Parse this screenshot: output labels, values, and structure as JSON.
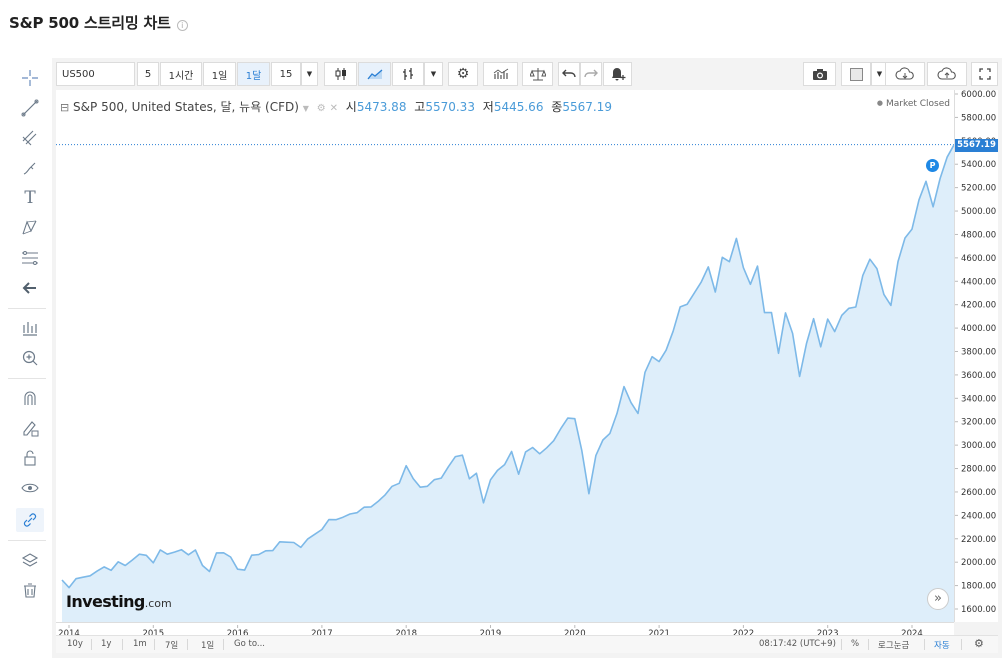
{
  "page": {
    "title": "S&P 500 스트리밍 차트",
    "info_icon": "info-icon"
  },
  "toolbar": {
    "symbol": "US500",
    "interval_5": "5",
    "interval_1h": "1시간",
    "interval_1d": "1일",
    "interval_1w": "1달",
    "interval_custom": "15",
    "dropdown_icon": "chevron-down-icon",
    "icons": [
      "candlestick-icon",
      "area-chart-icon",
      "ohlc-bars-icon",
      "settings-gear-icon",
      "indicators-icon",
      "compare-scale-icon",
      "undo-icon",
      "redo-icon",
      "add-alert-icon",
      "camera-icon",
      "color-square-icon",
      "cloud-download-icon",
      "cloud-upload-icon",
      "fullscreen-icon"
    ]
  },
  "left_tools": [
    "crosshair-icon",
    "trend-line-icon",
    "pitchfork-icon",
    "brush-icon",
    "text-icon",
    "pattern-icon",
    "fib-retracement-icon",
    "back-arrow-icon",
    "measure-icon",
    "zoom-in-icon",
    "magnet-icon",
    "lock-pencil-icon",
    "lock-open-icon",
    "eye-icon",
    "link-icon",
    "layers-icon",
    "trash-icon"
  ],
  "legend": {
    "name": "S&P 500, United States, 달, 뉴욕 (CFD)",
    "open_label": "시",
    "open": "5473.88",
    "high_label": "고",
    "high": "5570.33",
    "low_label": "저",
    "low": "5445.66",
    "close_label": "종",
    "close": "5567.19"
  },
  "market_status": "Market Closed",
  "logo": {
    "main": "Investing",
    "suffix": ".com"
  },
  "p_marker": "P",
  "last_price_tag": "5567.19",
  "bottom_bar": {
    "ranges": [
      "10y",
      "1y",
      "1m",
      "7일",
      "1일"
    ],
    "goto": "Go to...",
    "time": "08:17:42 (UTC+9)",
    "percent": "%",
    "log": "로그눈금",
    "auto": "자동",
    "settings_icon": "gear-icon"
  },
  "colors": {
    "line": "#7db9e8",
    "fill": "#deeefa",
    "accent": "#2a7fd4",
    "last_price_line": "#2a7fd4"
  },
  "chart_data": {
    "type": "area",
    "title": "S&P 500 스트리밍 차트",
    "xlabel": "",
    "ylabel": "",
    "ylim": [
      1500,
      6100
    ],
    "y_ticks": [
      1600,
      1800,
      2000,
      2200,
      2400,
      2600,
      2800,
      3000,
      3200,
      3400,
      3600,
      3800,
      4000,
      4200,
      4400,
      4600,
      4800,
      5000,
      5200,
      5400,
      5600,
      5800,
      6000
    ],
    "x_ticks": [
      "2014",
      "2015",
      "2016",
      "2017",
      "2018",
      "2019",
      "2020",
      "2021",
      "2022",
      "2023",
      "2024"
    ],
    "xlim": [
      "2013-11",
      "2024-07"
    ],
    "grid": false,
    "last_value": 5567.19,
    "series": [
      {
        "name": "S&P 500",
        "x": [
          "2013-12",
          "2014-01",
          "2014-02",
          "2014-03",
          "2014-04",
          "2014-05",
          "2014-06",
          "2014-07",
          "2014-08",
          "2014-09",
          "2014-10",
          "2014-11",
          "2014-12",
          "2015-01",
          "2015-02",
          "2015-03",
          "2015-04",
          "2015-05",
          "2015-06",
          "2015-07",
          "2015-08",
          "2015-09",
          "2015-10",
          "2015-11",
          "2015-12",
          "2016-01",
          "2016-02",
          "2016-03",
          "2016-04",
          "2016-05",
          "2016-06",
          "2016-07",
          "2016-08",
          "2016-09",
          "2016-10",
          "2016-11",
          "2016-12",
          "2017-01",
          "2017-02",
          "2017-03",
          "2017-04",
          "2017-05",
          "2017-06",
          "2017-07",
          "2017-08",
          "2017-09",
          "2017-10",
          "2017-11",
          "2017-12",
          "2018-01",
          "2018-02",
          "2018-03",
          "2018-04",
          "2018-05",
          "2018-06",
          "2018-07",
          "2018-08",
          "2018-09",
          "2018-10",
          "2018-11",
          "2018-12",
          "2019-01",
          "2019-02",
          "2019-03",
          "2019-04",
          "2019-05",
          "2019-06",
          "2019-07",
          "2019-08",
          "2019-09",
          "2019-10",
          "2019-11",
          "2019-12",
          "2020-01",
          "2020-02",
          "2020-03",
          "2020-04",
          "2020-05",
          "2020-06",
          "2020-07",
          "2020-08",
          "2020-09",
          "2020-10",
          "2020-11",
          "2020-12",
          "2021-01",
          "2021-02",
          "2021-03",
          "2021-04",
          "2021-05",
          "2021-06",
          "2021-07",
          "2021-08",
          "2021-09",
          "2021-10",
          "2021-11",
          "2021-12",
          "2022-01",
          "2022-02",
          "2022-03",
          "2022-04",
          "2022-05",
          "2022-06",
          "2022-07",
          "2022-08",
          "2022-09",
          "2022-10",
          "2022-11",
          "2022-12",
          "2023-01",
          "2023-02",
          "2023-03",
          "2023-04",
          "2023-05",
          "2023-06",
          "2023-07",
          "2023-08",
          "2023-09",
          "2023-10",
          "2023-11",
          "2023-12",
          "2024-01",
          "2024-02",
          "2024-03",
          "2024-04",
          "2024-05",
          "2024-06",
          "2024-07"
        ],
        "values": [
          1848,
          1783,
          1859,
          1872,
          1884,
          1924,
          1960,
          1931,
          2003,
          1972,
          2018,
          2068,
          2059,
          1995,
          2105,
          2068,
          2086,
          2107,
          2063,
          2104,
          1972,
          1920,
          2079,
          2080,
          2044,
          1940,
          1932,
          2060,
          2065,
          2097,
          2099,
          2174,
          2171,
          2168,
          2126,
          2199,
          2239,
          2279,
          2364,
          2363,
          2384,
          2412,
          2423,
          2470,
          2472,
          2519,
          2575,
          2648,
          2674,
          2824,
          2714,
          2641,
          2648,
          2705,
          2718,
          2816,
          2902,
          2914,
          2712,
          2760,
          2507,
          2704,
          2784,
          2834,
          2946,
          2752,
          2942,
          2980,
          2926,
          2977,
          3038,
          3141,
          3231,
          3226,
          2954,
          2585,
          2912,
          3044,
          3100,
          3271,
          3500,
          3363,
          3270,
          3622,
          3756,
          3714,
          3811,
          3973,
          4181,
          4204,
          4298,
          4395,
          4523,
          4308,
          4605,
          4567,
          4766,
          4516,
          4374,
          4530,
          4132,
          4132,
          3785,
          4130,
          3955,
          3586,
          3872,
          4080,
          3840,
          4077,
          3970,
          4109,
          4169,
          4180,
          4450,
          4589,
          4508,
          4288,
          4194,
          4568,
          4770,
          4846,
          5096,
          5254,
          5036,
          5278,
          5460,
          5567
        ]
      }
    ]
  }
}
